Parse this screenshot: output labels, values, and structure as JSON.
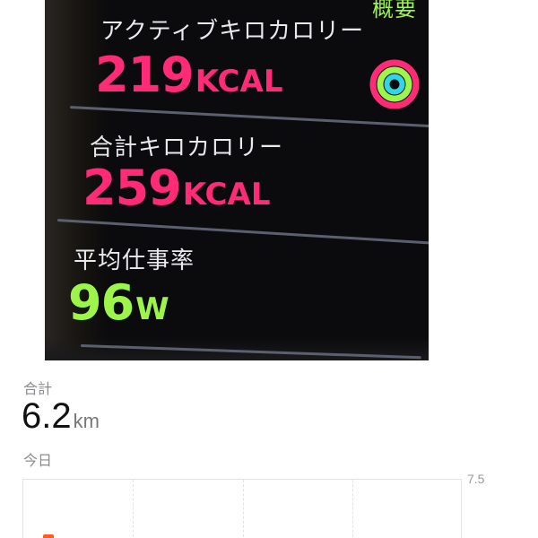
{
  "watch": {
    "top_partial_title": "概要",
    "active_calories": {
      "label": "アクティブキロカロリー",
      "value": "219",
      "unit": "KCAL"
    },
    "total_calories": {
      "label": "合計キロカロリー",
      "value": "259",
      "unit": "KCAL"
    },
    "average_power": {
      "label": "平均仕事率",
      "value": "96",
      "unit": "W"
    },
    "ring_colors": {
      "move": "#ff2b77",
      "exercise": "#9ef54a",
      "stand": "#2fd6e8"
    }
  },
  "summary": {
    "total_label": "合計",
    "distance_value": "6.2",
    "distance_unit": "km",
    "period_label": "今日"
  },
  "chart_data": {
    "type": "bar",
    "ylim": [
      0,
      7.5
    ],
    "y_max_label": "7.5",
    "bar_color": "#ff5a1f",
    "values": [
      0.3
    ]
  }
}
